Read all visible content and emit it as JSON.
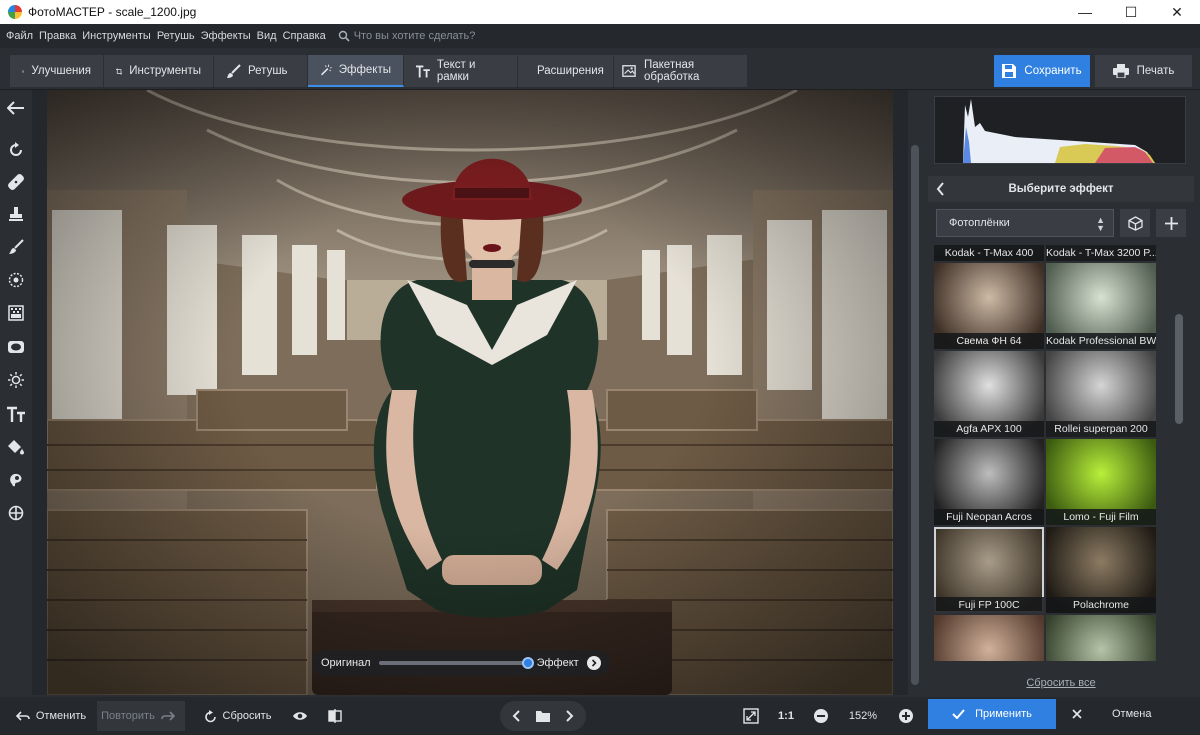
{
  "window": {
    "title": "ФотоМАСТЕР - scale_1200.jpg",
    "minimize": "—",
    "maximize": "☐",
    "close": "✕"
  },
  "menu": {
    "items": [
      "Файл",
      "Правка",
      "Инструменты",
      "Ретушь",
      "Эффекты",
      "Вид",
      "Справка"
    ],
    "search_placeholder": "Что вы хотите сделать?"
  },
  "toolbar": {
    "tabs": [
      "Улучшения",
      "Инструменты",
      "Ретушь",
      "Эффекты",
      "Текст и рамки",
      "Расширения"
    ],
    "active_tab": "Эффекты",
    "batch": "Пакетная обработка",
    "save": "Сохранить",
    "print": "Печать"
  },
  "left_tools": [
    "back-arrow-icon",
    "rotate-icon",
    "healing-patch-icon",
    "stamp-icon",
    "brush-icon",
    "radial-filter-icon",
    "gradient-filter-icon",
    "vignette-icon",
    "light-icon",
    "text-icon",
    "fill-icon",
    "selection-icon",
    "crosshair-icon"
  ],
  "compare": {
    "original": "Оригинал",
    "effect": "Эффект",
    "position": 1.0
  },
  "effects_panel": {
    "header": "Выберите эффект",
    "category": "Фотоплёнки",
    "reset_all": "Сбросить все",
    "tiles": [
      {
        "label": "Kodak - T-Max 400",
        "tone": "bw"
      },
      {
        "label": "Kodak - T-Max 3200 P...",
        "tone": "bw"
      },
      {
        "label": "Свема ФН 64",
        "tone": "sepia"
      },
      {
        "label": "Kodak Professional BW...",
        "tone": "greenish"
      },
      {
        "label": "Agfa APX 100",
        "tone": "bw"
      },
      {
        "label": "Rollei superpan 200",
        "tone": "bw"
      },
      {
        "label": "Fuji Neopan Acros",
        "tone": "bw"
      },
      {
        "label": "Lomo - Fuji Film",
        "tone": "lime"
      },
      {
        "label": "Fuji FP 100C",
        "tone": "warm",
        "selected": true
      },
      {
        "label": "Polachrome",
        "tone": "dark"
      },
      {
        "label": "",
        "tone": "color"
      },
      {
        "label": "",
        "tone": "cool"
      }
    ]
  },
  "bottom": {
    "undo": "Отменить",
    "redo": "Повторить",
    "reset": "Сбросить",
    "ratio": "1:1",
    "zoom": "152%",
    "apply": "Применить",
    "cancel": "Отмена"
  },
  "colors": {
    "accent": "#2f80e0",
    "background": "#2b2e33",
    "hat": "#7a1d1f",
    "dress": "#1f3328"
  }
}
